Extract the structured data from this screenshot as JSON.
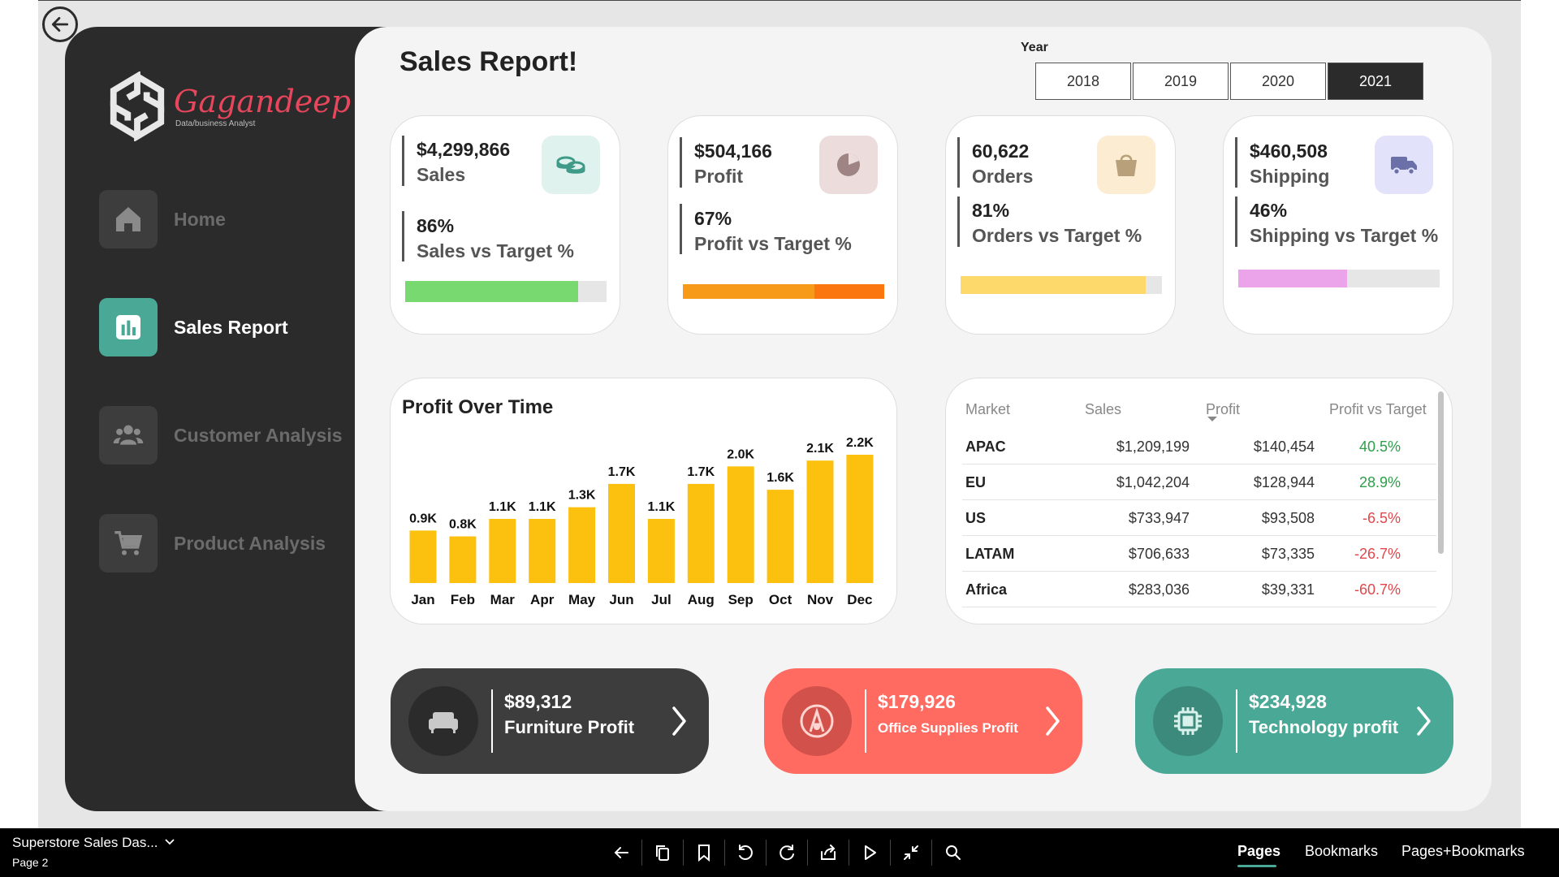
{
  "sidebar": {
    "logo_name": "Gagandeep",
    "logo_sub": "Data/business Analyst",
    "items": [
      {
        "label": "Home",
        "icon": "home-icon"
      },
      {
        "label": "Sales Report",
        "icon": "bar-chart-icon"
      },
      {
        "label": "Customer Analysis",
        "icon": "users-icon"
      },
      {
        "label": "Product Analysis",
        "icon": "cart-icon"
      }
    ],
    "active_item": "Sales Report"
  },
  "header": {
    "title": "Sales Report!",
    "year_label": "Year",
    "years": [
      "2018",
      "2019",
      "2020",
      "2021"
    ],
    "selected_year": "2021"
  },
  "kpis": [
    {
      "value": "$4,299,866",
      "label": "Sales",
      "pct": "86%",
      "pct_label": "Sales vs Target %",
      "progress": 0.86,
      "color": "#77d96f",
      "icon": "coins-icon",
      "icon_bg": "#dff2ee",
      "icon_color": "#3f9a88"
    },
    {
      "value": "$504,166",
      "label": "Profit",
      "pct": "67%",
      "pct_label": "Profit vs Target %",
      "progress": 1.0,
      "color": "#f79a1a",
      "icon": "pie-icon",
      "icon_bg": "#ecdcdc",
      "icon_color": "#9f8484"
    },
    {
      "value": "60,622",
      "label": "Orders",
      "pct": "81%",
      "pct_label": "Orders vs Target %",
      "progress": 0.92,
      "color": "#fcd96a",
      "icon": "shopping-bag-icon",
      "icon_bg": "#fcecd2",
      "icon_color": "#b8a07a"
    },
    {
      "value": "$460,508",
      "label": "Shipping",
      "pct": "46%",
      "pct_label": "Shipping vs Target %",
      "progress": 0.54,
      "color": "#eba3ea",
      "icon": "truck-icon",
      "icon_bg": "#e2e3fb",
      "icon_color": "#6b70a8"
    }
  ],
  "chart_data": {
    "type": "bar",
    "title": "Profit Over Time",
    "categories": [
      "Jan",
      "Feb",
      "Mar",
      "Apr",
      "May",
      "Jun",
      "Jul",
      "Aug",
      "Sep",
      "Oct",
      "Nov",
      "Dec"
    ],
    "values": [
      0.9,
      0.8,
      1.1,
      1.1,
      1.3,
      1.7,
      1.1,
      1.7,
      2.0,
      1.6,
      2.1,
      2.2
    ],
    "labels": [
      "0.9K",
      "0.8K",
      "1.1K",
      "1.1K",
      "1.3K",
      "1.7K",
      "1.1K",
      "1.7K",
      "2.0K",
      "1.6K",
      "2.1K",
      "2.2K"
    ],
    "unit": "K",
    "color": "#fcc10f"
  },
  "market_table": {
    "columns": [
      "Market",
      "Sales",
      "Profit",
      "Profit vs Target"
    ],
    "sorted_by": "Profit",
    "rows": [
      {
        "market": "APAC",
        "sales": "$1,209,199",
        "profit": "$140,454",
        "pvt": "40.5%",
        "positive": true
      },
      {
        "market": "EU",
        "sales": "$1,042,204",
        "profit": "$128,944",
        "pvt": "28.9%",
        "positive": true
      },
      {
        "market": "US",
        "sales": "$733,947",
        "profit": "$93,508",
        "pvt": "-6.5%",
        "positive": false
      },
      {
        "market": "LATAM",
        "sales": "$706,633",
        "profit": "$73,335",
        "pvt": "-26.7%",
        "positive": false
      },
      {
        "market": "Africa",
        "sales": "$283,036",
        "profit": "$39,331",
        "pvt": "-60.7%",
        "positive": false
      }
    ]
  },
  "categories": [
    {
      "value": "$89,312",
      "label": "Furniture Profit",
      "bg": "#3d3d3d",
      "circle": "#2b2b2b",
      "icon": "armchair-icon"
    },
    {
      "value": "$179,926",
      "label": "Office Supplies Profit",
      "bg": "#ff6b61",
      "circle": "#d2514b",
      "icon": "pen-icon"
    },
    {
      "value": "$234,928",
      "label": "Technology profit",
      "bg": "#4aa896",
      "circle": "#3b8a7b",
      "icon": "chip-icon"
    }
  ],
  "taskbar": {
    "report_name": "Superstore Sales Das...",
    "page": "Page 2",
    "tabs": [
      "Pages",
      "Bookmarks",
      "Pages+Bookmarks"
    ],
    "active_tab": "Pages"
  }
}
